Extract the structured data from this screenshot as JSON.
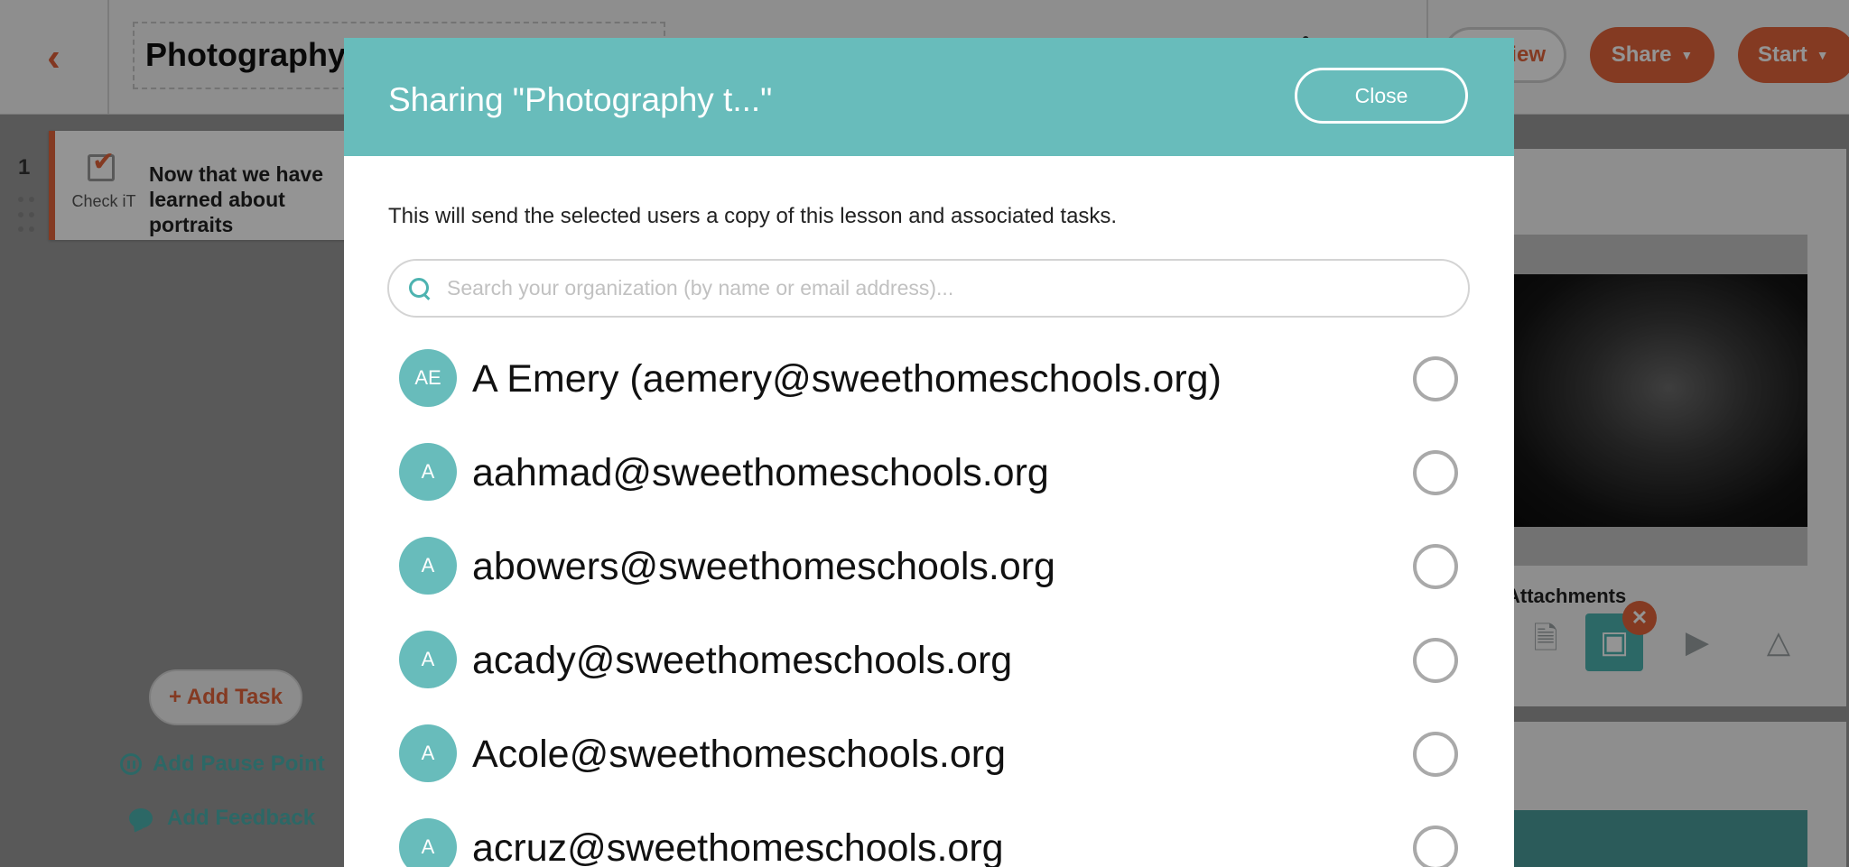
{
  "app": {
    "back_icon": "chevron-left-icon",
    "lesson_title": "Photography t...",
    "buttons": {
      "preview": "Preview",
      "share": "Share",
      "start": "Start"
    }
  },
  "tasks": [
    {
      "number": "1",
      "type_label": "Check iT",
      "text": "Now that we have learned about portraits"
    }
  ],
  "sidebar_actions": {
    "add_task": "+ Add Task",
    "add_pause_point": "Add Pause Point",
    "add_feedback": "Add Feedback"
  },
  "right_panel": {
    "attachments_label": "Attachments"
  },
  "modal": {
    "title": "Sharing \"Photography t...\"",
    "close_label": "Close",
    "description": "This will send the selected users a copy of this lesson and associated tasks.",
    "search": {
      "placeholder": "Search your organization (by name or email address)...",
      "value": ""
    },
    "users": [
      {
        "initials": "AE",
        "label": "A Emery (aemery@sweethomeschools.org)",
        "selected": false
      },
      {
        "initials": "A",
        "label": "aahmad@sweethomeschools.org",
        "selected": false
      },
      {
        "initials": "A",
        "label": "abowers@sweethomeschools.org",
        "selected": false
      },
      {
        "initials": "A",
        "label": "acady@sweethomeschools.org",
        "selected": false
      },
      {
        "initials": "A",
        "label": "Acole@sweethomeschools.org",
        "selected": false
      },
      {
        "initials": "A",
        "label": "acruz@sweethomeschools.org",
        "selected": false
      }
    ]
  },
  "colors": {
    "accent_orange": "#e3653c",
    "teal": "#68bcbb",
    "teal_dark": "#4db3b0"
  }
}
